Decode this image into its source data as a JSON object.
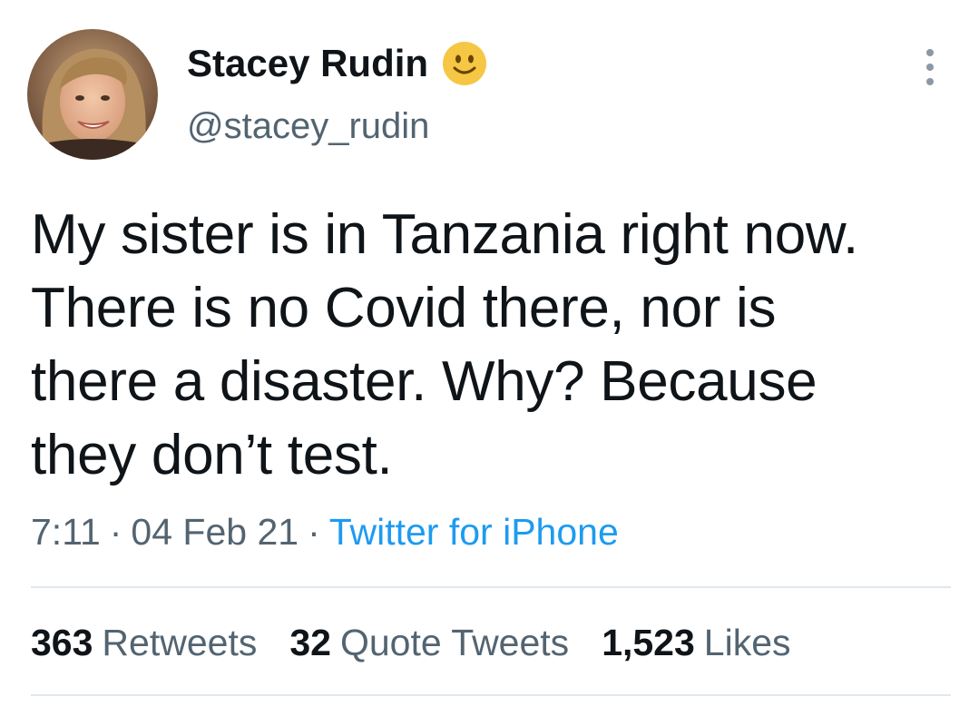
{
  "tweet": {
    "author": {
      "display_name": "Stacey Rudin",
      "handle": "@stacey_rudin",
      "name_emoji": "slightly-smiling-face-emoji"
    },
    "text": "My sister is in Tanzania right now.\nThere is no Covid there, nor is\nthere a disaster. Why? Because\nthey don’t test.",
    "time": "7:11",
    "date": "04 Feb 21",
    "separator": "·",
    "source": "Twitter for iPhone",
    "stats": {
      "retweets": {
        "count": "363",
        "label": "Retweets"
      },
      "quote_tweets": {
        "count": "32",
        "label": "Quote Tweets"
      },
      "likes": {
        "count": "1,523",
        "label": "Likes"
      }
    }
  },
  "icons": {
    "more": "more-vertical-icon"
  },
  "colors": {
    "text": "#0f1419",
    "secondary": "#536471",
    "link": "#1d9bf0",
    "divider": "#e1e8ed"
  }
}
